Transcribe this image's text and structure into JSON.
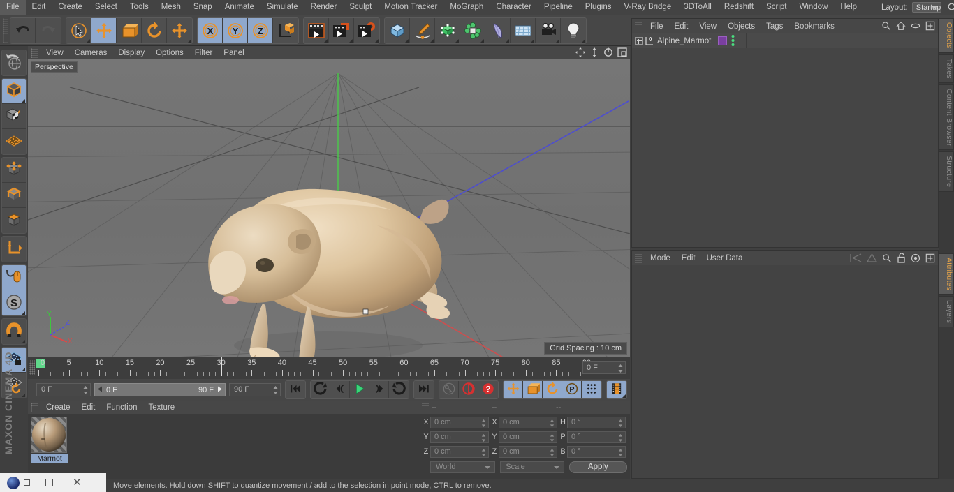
{
  "app": {
    "brand_top": "MAXON",
    "brand_bottom": "CINEMA 4D"
  },
  "menubar": {
    "items": [
      "File",
      "Edit",
      "Create",
      "Select",
      "Tools",
      "Mesh",
      "Snap",
      "Animate",
      "Simulate",
      "Render",
      "Sculpt",
      "Motion Tracker",
      "MoGraph",
      "Character",
      "Pipeline",
      "Plugins",
      "V-Ray Bridge",
      "3DToAll",
      "Redshift",
      "Script",
      "Window",
      "Help"
    ],
    "layout_label": "Layout:",
    "layout_value": "Startup",
    "search_icon": "search-icon"
  },
  "toolbar": {
    "groups": [
      {
        "name": "undo-redo",
        "buttons": [
          {
            "name": "undo-button",
            "icon": "undo-arrow-icon",
            "active": false,
            "corner": false
          },
          {
            "name": "redo-button",
            "icon": "redo-arrow-icon",
            "active": false,
            "corner": false
          }
        ]
      },
      {
        "name": "transform-tools",
        "buttons": [
          {
            "name": "select-tool-button",
            "icon": "live-selection-icon",
            "active": false,
            "corner": true
          },
          {
            "name": "move-tool-button",
            "icon": "move-icon",
            "active": true,
            "corner": false
          },
          {
            "name": "scale-tool-button",
            "icon": "scale-icon",
            "active": false,
            "corner": false
          },
          {
            "name": "rotate-tool-button",
            "icon": "rotate-icon",
            "active": false,
            "corner": false
          },
          {
            "name": "move-free-button",
            "icon": "move-icon",
            "active": false,
            "corner": true
          }
        ]
      },
      {
        "name": "axis-locks",
        "buttons": [
          {
            "name": "lock-x-button",
            "icon": "x-axis-icon",
            "active": true,
            "corner": false
          },
          {
            "name": "lock-y-button",
            "icon": "y-axis-icon",
            "active": true,
            "corner": false
          },
          {
            "name": "lock-z-button",
            "icon": "z-axis-icon",
            "active": true,
            "corner": false
          },
          {
            "name": "world-object-coord-button",
            "icon": "world-axis-icon",
            "active": false,
            "corner": false
          }
        ]
      },
      {
        "name": "render-tools",
        "buttons": [
          {
            "name": "render-view-button",
            "icon": "render-view-icon",
            "active": false,
            "corner": true
          },
          {
            "name": "render-region-button",
            "icon": "render-region-icon",
            "active": false,
            "corner": true
          },
          {
            "name": "render-settings-button",
            "icon": "render-settings-icon",
            "active": false,
            "corner": true
          }
        ]
      },
      {
        "name": "create-objects",
        "buttons": [
          {
            "name": "primitive-cube-button",
            "icon": "cube-icon",
            "active": false,
            "corner": true
          },
          {
            "name": "spline-pen-button",
            "icon": "pen-spline-icon",
            "active": false,
            "corner": true
          },
          {
            "name": "generator-button",
            "icon": "generator-cube-icon",
            "active": false,
            "corner": true
          },
          {
            "name": "deformer-button",
            "icon": "deformer-icon",
            "active": false,
            "corner": true
          },
          {
            "name": "bend-button",
            "icon": "bend-icon",
            "active": false,
            "corner": true
          },
          {
            "name": "scene-floor-button",
            "icon": "floor-grid-icon",
            "active": false,
            "corner": true
          },
          {
            "name": "camera-button",
            "icon": "camera-icon",
            "active": false,
            "corner": true
          },
          {
            "name": "light-button",
            "icon": "light-bulb-icon",
            "active": false,
            "corner": true
          }
        ]
      }
    ]
  },
  "left_toolbar": {
    "groups": [
      {
        "name": "undo-view-group",
        "buttons": [
          {
            "name": "undo-view-button",
            "icon": "globe-undo-icon",
            "active": false,
            "corner": false
          }
        ]
      },
      {
        "name": "editable-group",
        "buttons": [
          {
            "name": "make-editable-button",
            "icon": "make-editable-cube-icon",
            "active": true,
            "corner": true
          },
          {
            "name": "model-mode-button",
            "icon": "texture-cube-icon",
            "active": false,
            "corner": false
          },
          {
            "name": "texture-mode-button",
            "icon": "texture-grid-icon",
            "active": false,
            "corner": false
          }
        ]
      },
      {
        "name": "component-group",
        "buttons": [
          {
            "name": "points-mode-button",
            "icon": "points-cube-icon",
            "active": false,
            "corner": false
          },
          {
            "name": "edges-mode-button",
            "icon": "edges-cube-icon",
            "active": false,
            "corner": false
          },
          {
            "name": "polygons-mode-button",
            "icon": "polygons-cube-icon",
            "active": false,
            "corner": false
          }
        ]
      },
      {
        "name": "axis-group",
        "buttons": [
          {
            "name": "enable-axis-button",
            "icon": "axis-l-icon",
            "active": false,
            "corner": false
          }
        ]
      },
      {
        "name": "viewport-group",
        "buttons": [
          {
            "name": "viewport-solo-button",
            "icon": "mouse-curve-icon",
            "active": true,
            "corner": false
          },
          {
            "name": "soft-selection-button",
            "icon": "s-circle-icon",
            "active": true,
            "corner": true
          }
        ]
      },
      {
        "name": "magnet-group",
        "buttons": [
          {
            "name": "magnet-button",
            "icon": "magnet-icon",
            "active": false,
            "corner": true
          }
        ]
      },
      {
        "name": "lock-group",
        "buttons": [
          {
            "name": "lock-workplane-button",
            "icon": "grid-lock-icon",
            "active": true,
            "corner": true
          },
          {
            "name": "workplane-toggle-button",
            "icon": "grid-rotate-icon",
            "active": false,
            "corner": true
          }
        ]
      }
    ]
  },
  "viewport": {
    "menus": [
      "View",
      "Cameras",
      "Display",
      "Options",
      "Filter",
      "Panel"
    ],
    "corner_icons": [
      "pan-view-icon",
      "dolly-view-icon",
      "rotate-view-icon",
      "maximize-view-icon"
    ],
    "label": "Perspective",
    "grid_spacing": "Grid Spacing : 10 cm",
    "axis_gizmo": {
      "x": "X",
      "y": "Y",
      "z": "Z"
    }
  },
  "timeline": {
    "ticks": [
      {
        "label": "0",
        "frame": 0
      },
      {
        "label": "5",
        "frame": 5
      },
      {
        "label": "10",
        "frame": 10
      },
      {
        "label": "15",
        "frame": 15
      },
      {
        "label": "20",
        "frame": 20
      },
      {
        "label": "25",
        "frame": 25
      },
      {
        "label": "30",
        "frame": 30
      },
      {
        "label": "35",
        "frame": 35
      },
      {
        "label": "40",
        "frame": 40
      },
      {
        "label": "45",
        "frame": 45
      },
      {
        "label": "50",
        "frame": 50
      },
      {
        "label": "55",
        "frame": 55
      },
      {
        "label": "60",
        "frame": 60
      },
      {
        "label": "65",
        "frame": 65
      },
      {
        "label": "70",
        "frame": 70
      },
      {
        "label": "75",
        "frame": 75
      },
      {
        "label": "80",
        "frame": 80
      },
      {
        "label": "85",
        "frame": 85
      },
      {
        "label": "90",
        "frame": 90
      }
    ],
    "current_frame_field": "0 F",
    "range_start": 0,
    "range_end": 90,
    "playhead_frame": 0
  },
  "playback": {
    "current_frame": "0 F",
    "range_min": "0 F",
    "range_max": "90 F",
    "end_frame": "90 F",
    "buttons": [
      {
        "name": "go-to-start-button",
        "icon": "skip-start-icon",
        "active": false,
        "corner": false
      },
      {
        "name": "previous-keyframe-button",
        "icon": "prev-key-icon",
        "active": false,
        "corner": false
      },
      {
        "name": "step-back-button",
        "icon": "step-back-icon",
        "active": false,
        "corner": false
      },
      {
        "name": "play-button",
        "icon": "play-icon",
        "active": false,
        "corner": false
      },
      {
        "name": "step-forward-button",
        "icon": "step-forward-icon",
        "active": false,
        "corner": false
      },
      {
        "name": "next-keyframe-button",
        "icon": "next-key-icon",
        "active": false,
        "corner": false
      },
      {
        "name": "go-to-end-button",
        "icon": "skip-end-icon",
        "active": false,
        "corner": false
      },
      {
        "name": "autokey-button",
        "icon": "key-icon",
        "active": false,
        "corner": false
      },
      {
        "name": "record-active-objects-button",
        "icon": "record-icon",
        "active": false,
        "corner": false
      },
      {
        "name": "keyframe-help-button",
        "icon": "question-icon",
        "active": false,
        "corner": false
      },
      {
        "name": "record-position-button",
        "icon": "move-icon",
        "active": true,
        "corner": false
      },
      {
        "name": "record-scale-button",
        "icon": "scale-icon",
        "active": true,
        "corner": false
      },
      {
        "name": "record-rotation-button",
        "icon": "rotate-icon",
        "active": true,
        "corner": false
      },
      {
        "name": "record-parameter-button",
        "icon": "p-circle-icon",
        "active": true,
        "corner": false
      },
      {
        "name": "pla-button",
        "icon": "point-level-anim-icon",
        "active": true,
        "corner": false
      },
      {
        "name": "timeline-mode-button",
        "icon": "film-strip-icon",
        "active": true,
        "corner": true
      }
    ]
  },
  "material_manager": {
    "menus": [
      "Create",
      "Edit",
      "Function",
      "Texture"
    ],
    "materials": [
      {
        "name": "Marmot",
        "selected": true
      }
    ]
  },
  "coordinates": {
    "header_fields": [
      "--",
      "--",
      "--"
    ],
    "rows": [
      {
        "pos_label": "X",
        "pos_value": "0 cm",
        "size_label": "X",
        "size_value": "0 cm",
        "rot_label": "H",
        "rot_value": "0 °"
      },
      {
        "pos_label": "Y",
        "pos_value": "0 cm",
        "size_label": "Y",
        "size_value": "0 cm",
        "rot_label": "P",
        "rot_value": "0 °"
      },
      {
        "pos_label": "Z",
        "pos_value": "0 cm",
        "size_label": "Z",
        "size_value": "0 cm",
        "rot_label": "B",
        "rot_value": "0 °"
      }
    ],
    "coord_system": "World",
    "transform_mode": "Scale",
    "apply_label": "Apply"
  },
  "object_manager": {
    "menus": [
      "File",
      "Edit",
      "View",
      "Objects",
      "Tags",
      "Bookmarks"
    ],
    "icons": [
      "search-icon",
      "home-icon",
      "ellipse-icon",
      "plus-box-icon"
    ],
    "objects": [
      {
        "name": "Alpine_Marmot",
        "layer_badge": "0",
        "tag_color": "#7a3fa0",
        "visible_dots": true
      }
    ]
  },
  "attribute_manager": {
    "menus": [
      "Mode",
      "Edit",
      "User Data"
    ],
    "icons": [
      "prev-nav-icon",
      "next-nav-icon",
      "search-icon",
      "unlock-icon",
      "target-icon",
      "plus-box-icon"
    ]
  },
  "right_tabs": {
    "top": [
      {
        "label": "Objects",
        "selected": true
      },
      {
        "label": "Takes",
        "selected": false
      },
      {
        "label": "Content Browser",
        "selected": false
      },
      {
        "label": "Structure",
        "selected": false
      }
    ],
    "bottom": [
      {
        "label": "Attributes",
        "selected": true
      },
      {
        "label": "Layers",
        "selected": false
      }
    ]
  },
  "statusbar": {
    "message": "Move elements. Hold down SHIFT to quantize movement / add to the selection in point mode, CTRL to remove."
  },
  "colors": {
    "accent_orange": "#e8922a",
    "active_blue": "#8fa8cc",
    "green_play": "#3ad47a",
    "panel_bg": "#3f3f3f",
    "toolbar_bg": "#474747"
  }
}
